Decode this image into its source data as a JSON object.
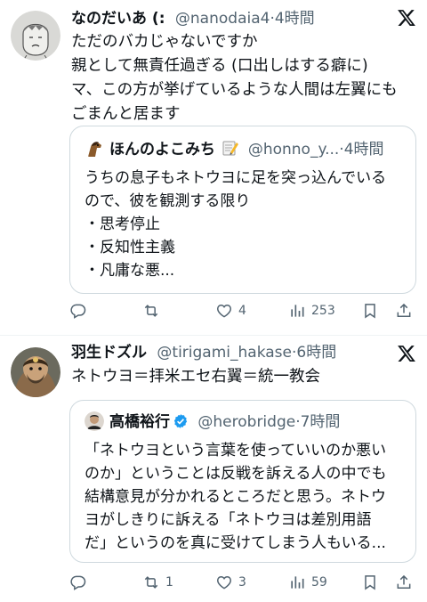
{
  "posts": [
    {
      "name": "なのだいあ (:",
      "handle": "@nanodaia4",
      "time": "·4時間",
      "lines": [
        "ただのバカじゃないですか",
        "親として無責任過ぎる (口出しはする癖に)",
        "マ、この方が挙げているような人間は左翼にも",
        "ごまんと居ます"
      ],
      "quote": {
        "name": "ほんのよこみち",
        "handle": "@honno_y...",
        "time": "·4時間",
        "lines": [
          "うちの息子もネトウヨに足を突っ込んでいる",
          "ので、彼を観測する限り",
          "・思考停止",
          "・反知性主義",
          "・凡庸な悪..."
        ]
      },
      "actions": {
        "reply": "",
        "retweet": "",
        "like": "4",
        "views": "253"
      }
    },
    {
      "name": "羽生ドズル",
      "handle": "@tirigami_hakase",
      "time": "·6時間",
      "lines": [
        "ネトウヨ＝拝米エセ右翼＝統一教会"
      ],
      "quote": {
        "name": "高橋裕行",
        "handle": "@herobridge",
        "time": "·7時間",
        "lines": [
          "「ネトウヨという言葉を使っていいのか悪い",
          "のか」ということは反戦を訴える人の中でも",
          "結構意見が分かれるところだと思う。ネトウ",
          "ヨがしきりに訴える「ネトウヨは差別用語",
          "だ」というのを真に受けてしまう人もいる..."
        ]
      },
      "actions": {
        "reply": "",
        "retweet": "1",
        "like": "3",
        "views": "59"
      }
    }
  ],
  "icons": [
    "x-logo-icon",
    "reply-icon",
    "retweet-icon",
    "like-icon",
    "views-icon",
    "bookmark-icon",
    "share-icon",
    "verified-icon",
    "memo-emoji-icon",
    "horse-emoji-icon"
  ],
  "colors": {
    "text": "#0f1419",
    "secondary": "#536471",
    "border": "#cfd9de",
    "verified": "#1d9bf0"
  }
}
